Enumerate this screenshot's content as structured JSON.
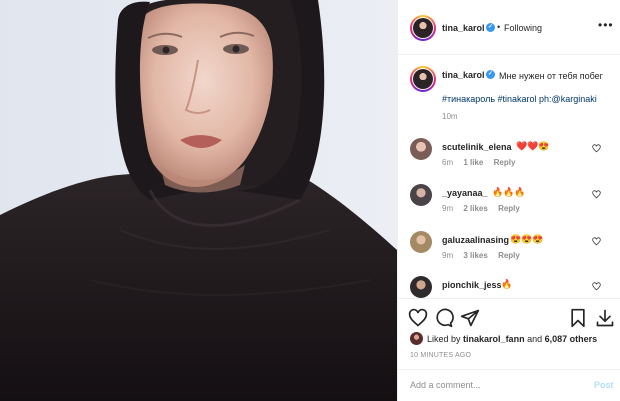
{
  "header": {
    "username": "tina_karol",
    "separator": "•",
    "follow_status": "Following",
    "more_glyph": "•••"
  },
  "caption": {
    "username": "tina_karol",
    "text": "Мне нужен от тебя побег",
    "hashtags": "#тинакароль #tinakarol ph:@karginaki",
    "time": "10m"
  },
  "comments": [
    {
      "username": "scutelinik_elena",
      "emoji": "❤️❤️😍",
      "time": "6m",
      "likes": "1 like",
      "reply": "Reply"
    },
    {
      "username": "_yayanaa_",
      "emoji": "🔥🔥🔥",
      "time": "9m",
      "likes": "2 likes",
      "reply": "Reply"
    },
    {
      "username": "galuzaalinasing",
      "emoji": "😍😍😍",
      "time": "9m",
      "likes": "3 likes",
      "reply": "Reply"
    },
    {
      "username": "pionchik_jess",
      "emoji": "🔥",
      "time": "",
      "likes": "",
      "reply": ""
    }
  ],
  "likes": {
    "prefix": "Liked by",
    "user": "tinakarol_fann",
    "middle": "and",
    "count": "6,087 others"
  },
  "post_date": "10 MINUTES AGO",
  "add_comment": {
    "placeholder": "Add a comment...",
    "post_label": "Post"
  },
  "icons": {
    "verified": "verified-badge-icon",
    "like": "heart-icon",
    "comment": "comment-bubble-icon",
    "share": "paper-plane-icon",
    "save": "bookmark-icon",
    "download": "download-icon"
  },
  "colors": {
    "verified_blue": "#3897f0",
    "link_blue": "#00376b",
    "muted_grey": "#8e8e8e",
    "post_button_disabled": "#b2dffc",
    "border": "#efefef"
  }
}
